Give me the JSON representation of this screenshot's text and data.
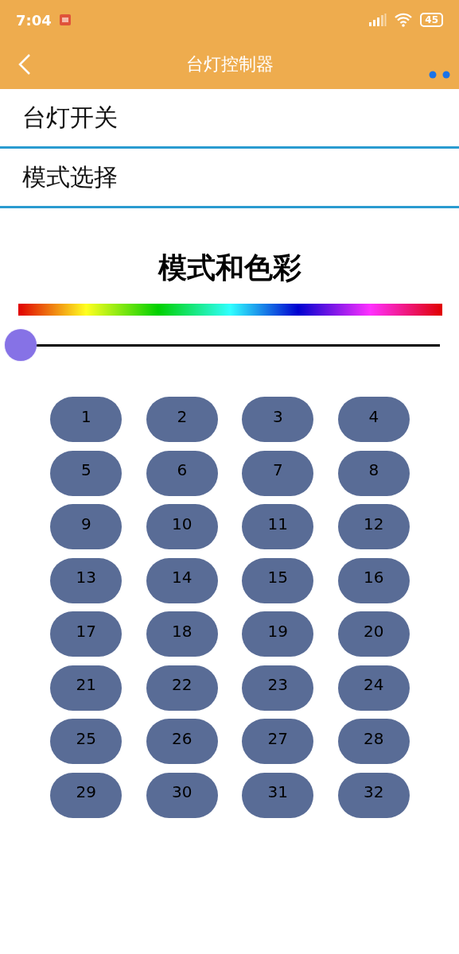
{
  "status_bar": {
    "time": "7:04",
    "battery": "45"
  },
  "header": {
    "title": "台灯控制器"
  },
  "menu": [
    {
      "label": "台灯开关"
    },
    {
      "label": "模式选择"
    }
  ],
  "section_title": "模式和色彩",
  "slider": {
    "level": 0
  },
  "mode_buttons": [
    "1",
    "2",
    "3",
    "4",
    "5",
    "6",
    "7",
    "8",
    "9",
    "10",
    "11",
    "12",
    "13",
    "14",
    "15",
    "16",
    "17",
    "18",
    "19",
    "20",
    "21",
    "22",
    "23",
    "24",
    "25",
    "26",
    "27",
    "28",
    "29",
    "30",
    "31",
    "32"
  ]
}
